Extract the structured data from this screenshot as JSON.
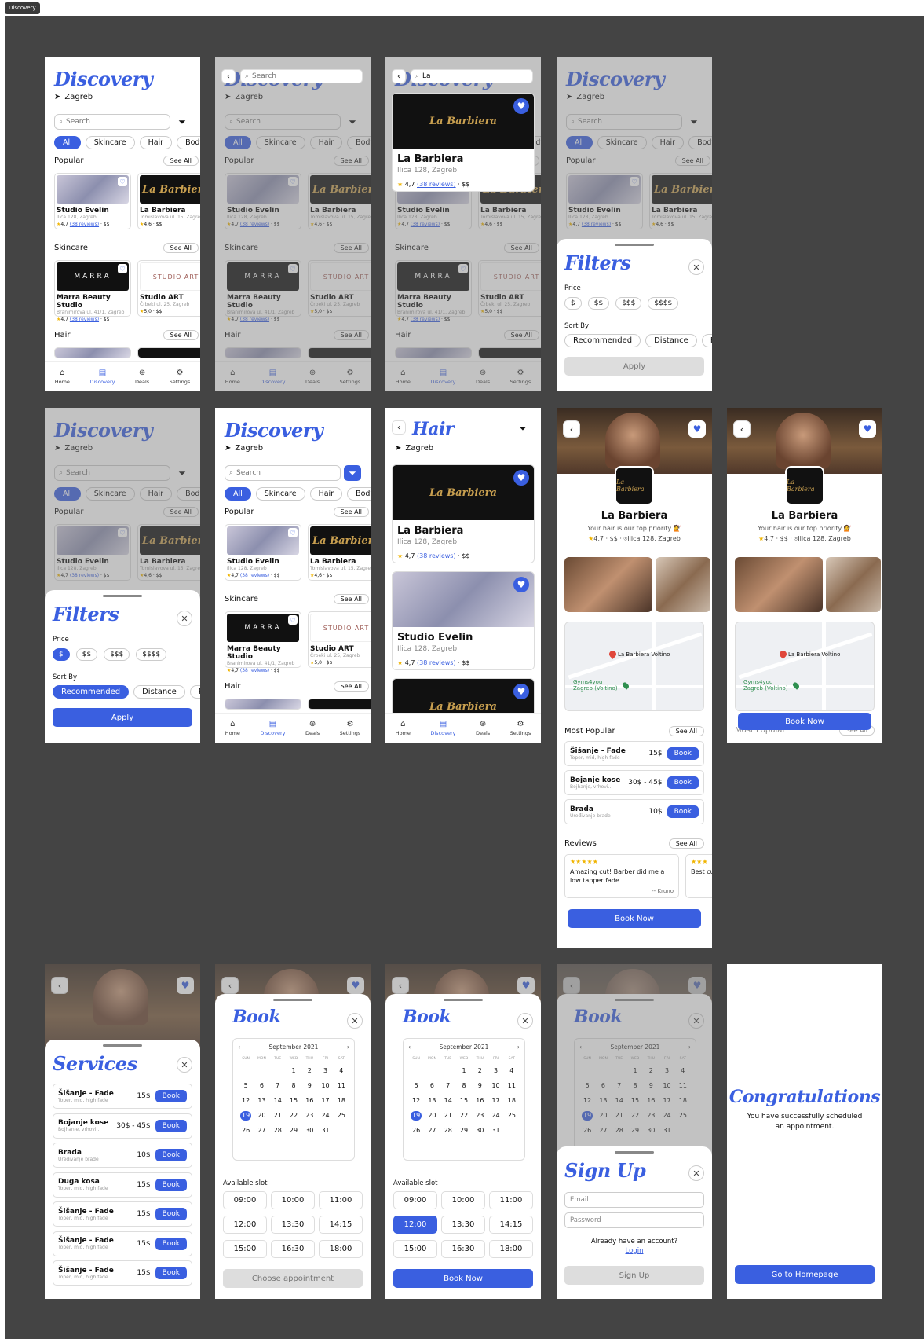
{
  "frame_label": "Discovery",
  "colors": {
    "accent": "#3a5fe0",
    "canvas": "#444444",
    "star": "#f0b400"
  },
  "discovery": {
    "title": "Discovery",
    "location": "Zagreb",
    "search_placeholder": "Search",
    "chips": [
      "All",
      "Skincare",
      "Hair",
      "Body"
    ],
    "popular_label": "Popular",
    "skincare_label": "Skincare",
    "hair_label": "Hair",
    "see_all": "See All",
    "popular_cards": [
      {
        "name": "Studio Evelin",
        "address": "Ilica 128, Zagreb",
        "rating": "4,7",
        "reviews": "(38 reviews)",
        "price": "· $$"
      },
      {
        "name": "La Barbiera",
        "address": "Tomislavova ul. 15, Zagreb",
        "rating": "4,6",
        "reviews": "",
        "price": "· $$"
      }
    ],
    "skincare_cards": [
      {
        "name": "Marra Beauty Studio",
        "address": "Branimirova ul. 41/1, Zagreb",
        "rating": "4,7",
        "reviews": "(38 reviews)",
        "price": "· $$"
      },
      {
        "name": "Studio ART",
        "address": "Črbeki ul. 25, Zagreb",
        "rating": "5,0",
        "reviews": "",
        "price": "· $$"
      }
    ],
    "logo_barbiera": "La Barbiera",
    "logo_marra": "MARRA",
    "logo_studio": "STUDIO ART"
  },
  "nav": [
    "Home",
    "Discovery",
    "Deals",
    "Settings"
  ],
  "search_screen": {
    "placeholder": "Search",
    "query": "La",
    "result": {
      "name": "La Barbiera",
      "address": "Ilica 128, Zagreb",
      "rating": "4,7",
      "reviews": "(38 reviews)",
      "price": "· $$"
    }
  },
  "filters": {
    "title": "Filters",
    "price_label": "Price",
    "prices": [
      "$",
      "$$",
      "$$$",
      "$$$$"
    ],
    "sort_label": "Sort By",
    "sorts": [
      "Recommended",
      "Distance",
      "Rat"
    ],
    "apply": "Apply"
  },
  "hair_screen": {
    "title": "Hair",
    "location": "Zagreb",
    "cards": [
      {
        "name": "La Barbiera",
        "address": "Ilica 128, Zagreb",
        "rating": "4,7",
        "reviews": "(38 reviews)",
        "price": "· $$"
      },
      {
        "name": "Studio Evelin",
        "address": "Ilica 128, Zagreb",
        "rating": "4,7",
        "reviews": "(38 reviews)",
        "price": "· $$"
      }
    ]
  },
  "shop": {
    "name": "La Barbiera",
    "tagline": "Your hair is our top priority 💇",
    "rating": "4,7",
    "price": "$$",
    "address": "Ilica 128, Zagreb",
    "map_pin1": "La Barbiera Voltino",
    "map_pin2": "Gyms4you Zagreb (Voltino)",
    "most_popular": "Most Popular",
    "see_all": "See All",
    "services": [
      {
        "title": "Šišanje - Fade",
        "sub": "Toper, mid, high fade",
        "price": "15$"
      },
      {
        "title": "Bojanje kose",
        "sub": "Bojhanje, vrhovi...",
        "price": "30$ - 45$"
      },
      {
        "title": "Brada",
        "sub": "Uređivanje brade",
        "price": "10$"
      }
    ],
    "book": "Book",
    "reviews_label": "Reviews",
    "reviews": [
      {
        "stars": "★★★★★",
        "text": "Amazing cut! Barber did me a low tapper fade.",
        "author": "-- Kruno"
      },
      {
        "stars": "★★★",
        "text": "Best cut e",
        "author": ""
      }
    ],
    "book_now": "Book Now",
    "logo": "La Barbiera"
  },
  "services_sheet": {
    "title": "Services",
    "items": [
      {
        "title": "Šišanje - Fade",
        "sub": "Toper, mid, high fade",
        "price": "15$"
      },
      {
        "title": "Bojanje kose",
        "sub": "Bojhanje, vrhovi...",
        "price": "30$ - 45$"
      },
      {
        "title": "Brada",
        "sub": "Uređivanje brade",
        "price": "10$"
      },
      {
        "title": "Duga kosa",
        "sub": "Toper, mid, high fade",
        "price": "15$"
      },
      {
        "title": "Šišanje - Fade",
        "sub": "Toper, mid, high fade",
        "price": "15$"
      },
      {
        "title": "Šišanje - Fade",
        "sub": "Toper, mid, high fade",
        "price": "15$"
      },
      {
        "title": "Šišanje - Fade",
        "sub": "Toper, mid, high fade",
        "price": "15$"
      }
    ],
    "book": "Book"
  },
  "booking": {
    "title": "Book",
    "month": "September 2021",
    "weekdays": [
      "SUN",
      "MON",
      "TUE",
      "WED",
      "THU",
      "FRI",
      "SAT"
    ],
    "days": [
      "",
      "",
      "",
      "1",
      "2",
      "3",
      "4",
      "5",
      "6",
      "7",
      "8",
      "9",
      "10",
      "11",
      "12",
      "13",
      "14",
      "15",
      "16",
      "17",
      "18",
      "19",
      "20",
      "21",
      "22",
      "23",
      "24",
      "25",
      "26",
      "27",
      "28",
      "29",
      "30",
      "31"
    ],
    "selected_day": "19",
    "slot_label": "Available slot",
    "slots": [
      "09:00",
      "10:00",
      "11:00",
      "12:00",
      "13:30",
      "14:15",
      "15:00",
      "16:30",
      "18:00"
    ],
    "selected_slot": "12:00",
    "choose": "Choose appointment",
    "book_now": "Book Now"
  },
  "signup": {
    "title": "Sign Up",
    "email": "Email",
    "password": "Password",
    "have_account": "Already have an account?",
    "login": "Login",
    "button": "Sign Up"
  },
  "congrats": {
    "title": "Congratulations",
    "text": "You have successfully scheduled an appointment.",
    "button": "Go to Homepage"
  }
}
